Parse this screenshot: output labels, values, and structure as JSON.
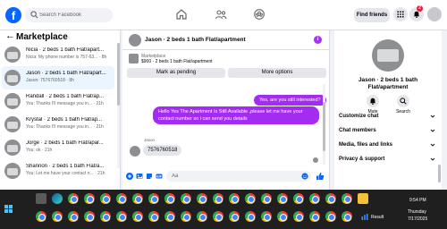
{
  "header": {
    "search_placeholder": "Search Facebook",
    "find_friends": "Find friends",
    "notif_count": "2"
  },
  "sidebar": {
    "title": "Marketplace",
    "threads": [
      {
        "title": "Nicia · 2 beds 1 bath Flat/apart...",
        "preview": "Nicia: My phone number is 757-63... · 8h",
        "active": false
      },
      {
        "title": "Jason · 2 beds 1 bath Flat/apart...",
        "preview": "Jason: 7576760518 · 8h",
        "active": true
      },
      {
        "title": "Randall · 2 beds 1 bath Flat/ap...",
        "preview": "You: Thanks I'll message you in... · 21h",
        "active": false
      },
      {
        "title": "Krystal · 2 beds 1 bath Flat/ap...",
        "preview": "You: Thanks I'll message you in... · 21h",
        "active": false
      },
      {
        "title": "Jorge · 2 beds 1 bath Flat/apar...",
        "preview": "You: ok · 21h",
        "active": false
      },
      {
        "title": "Shannon · 2 beds 1 bath Flat/a...",
        "preview": "You: Let me have your contact n... · 21h",
        "active": false
      }
    ]
  },
  "chat": {
    "title": "Jason · 2 beds 1 bath Flat/apartment",
    "listing_source": "Marketplace",
    "listing_detail": "$900 · 2 beds 1 bath Flat/apartment",
    "mark_pending": "Mark as pending",
    "more_options": "More options",
    "msg_out_1": "Yes, are you still interested?",
    "msg_out_2": "Hello Yes The Apartment Is Still Available ,please let me have your contact number so i can send you details",
    "in_sender": "Jason",
    "msg_in_1": "7576760518",
    "composer_placeholder": "Aa"
  },
  "info": {
    "name": "Jason · 2 beds 1 bath Flat/apartment",
    "mute": "Mute",
    "search": "Search",
    "rows": [
      "Customize chat",
      "Chat members",
      "Media, files and links",
      "Privacy & support"
    ]
  },
  "taskbar": {
    "result": "Result",
    "time": "9:54 PM",
    "day": "Thursday",
    "date": "7/17/2025"
  },
  "colors": {
    "brand": "#0866ff",
    "bubble_out": "#a32cf0"
  }
}
